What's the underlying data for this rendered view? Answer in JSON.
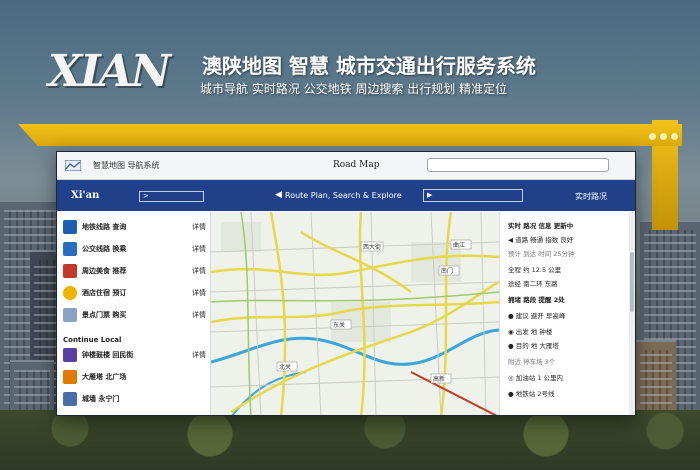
{
  "header": {
    "logo": "XIAN",
    "headline": "澳陕地图 智慧 城市交通出行服务系统",
    "subline": "城市导航 实时路况 公交地铁 周边搜索 出行规划 精准定位"
  },
  "window": {
    "title": "智慧地图 导航系统",
    "center_title": "Road Map",
    "search_placeholder": "",
    "nav": {
      "brand": "Xi'an",
      "small_field": ">",
      "back_arrow": "◀",
      "text": "Route Plan, Search & Explore",
      "box_value": "▶",
      "right": "实时路况"
    }
  },
  "left_panel": {
    "items": [
      {
        "label": "地铁线路 查询",
        "meta": "详情",
        "icon": "metro-icon",
        "color": "#1d5fb0"
      },
      {
        "label": "公交线路 换乘",
        "meta": "详情",
        "icon": "bus-icon",
        "color": "#2a6fbf"
      },
      {
        "label": "周边美食 推荐",
        "meta": "详情",
        "icon": "food-icon",
        "color": "#c0392b"
      },
      {
        "label": "酒店住宿 预订",
        "meta": "详情",
        "icon": "hotel-icon",
        "color": "#f0b400"
      },
      {
        "label": "景点门票 购买",
        "meta": "详情",
        "icon": "ticket-icon",
        "color": "#8aa2c4"
      }
    ],
    "section": "Continue Local",
    "items2": [
      {
        "label": "钟楼鼓楼 回民街",
        "meta": "详情",
        "icon": "pin-icon",
        "color": "#5b3fa0"
      },
      {
        "label": "大雁塔 北广场",
        "meta": "",
        "icon": "pagoda-icon",
        "color": "#e07b00"
      },
      {
        "label": "城墙 永宁门",
        "meta": "",
        "icon": "wall-icon",
        "color": "#4a6fa8"
      }
    ]
  },
  "map": {
    "labels": [
      "西大街",
      "南门",
      "东关",
      "北关",
      "高新",
      "曲江"
    ]
  },
  "right_panel": {
    "lines": [
      {
        "text": "实时 路况 信息 更新中",
        "style": "bold"
      },
      {
        "text": "◀ 道路 畅通 指数 良好",
        "style": "normal"
      },
      {
        "text": "预计 到达 时间 25分钟",
        "style": "muted"
      },
      {
        "text": "全程 约 12.5 公里",
        "style": "normal"
      },
      {
        "text": "途经 南二环 东路",
        "style": "normal"
      },
      {
        "text": "拥堵 路段 提醒 2处",
        "style": "bold"
      },
      {
        "text": "● 建议 避开 早高峰",
        "style": "normal"
      },
      {
        "text": "◉ 出发 地 钟楼",
        "style": "normal"
      },
      {
        "text": "● 目的 地 大雁塔",
        "style": "normal"
      },
      {
        "text": "附近 停车场 3个",
        "style": "muted"
      },
      {
        "text": "◎ 加油站 1 公里内",
        "style": "normal"
      },
      {
        "text": "● 地铁站 2号线",
        "style": "normal"
      }
    ]
  },
  "colors": {
    "navbar": "#20408a",
    "ribbon": "#f2c21a",
    "road_major": "#e6d84a",
    "river": "#3aa6d9"
  }
}
